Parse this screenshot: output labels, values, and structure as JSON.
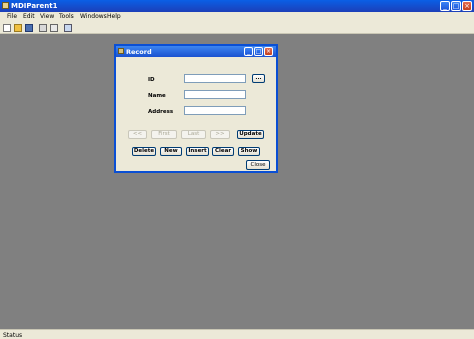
{
  "window": {
    "title": "MDIParent1"
  },
  "menu": {
    "items": [
      "File",
      "Edit",
      "View",
      "Tools",
      "Windows",
      "Help"
    ]
  },
  "toolbar": {
    "icons": [
      "new-icon",
      "open-icon",
      "save-icon",
      "print-icon",
      "print-preview-icon",
      "help-icon"
    ]
  },
  "status": {
    "text": "Status"
  },
  "record": {
    "title": "Record",
    "id_label": "ID",
    "name_label": "Name",
    "address_label": "Address",
    "id_value": "",
    "name_value": "",
    "address_value": "",
    "browse_label": "...",
    "nav": {
      "first_prev": "<<",
      "first": "First",
      "last": "Last",
      "next_last": ">>",
      "update": "Update"
    },
    "actions": {
      "delete": "Delete",
      "new": "New",
      "insert": "Insert",
      "clear": "Clear",
      "show": "Show"
    },
    "close_label": "Close"
  }
}
